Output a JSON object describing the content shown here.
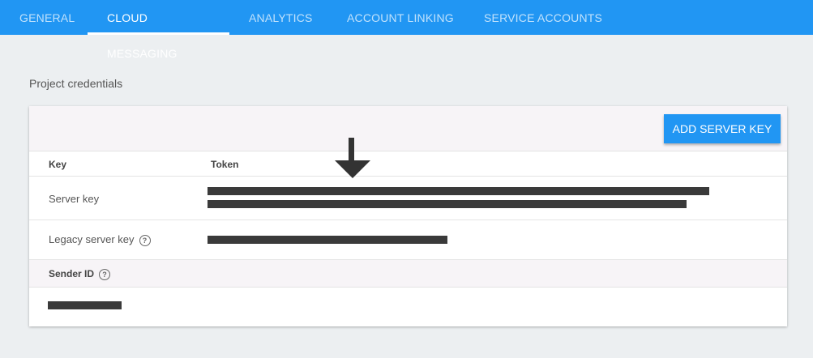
{
  "tabs": [
    {
      "label": "GENERAL"
    },
    {
      "label": "CLOUD MESSAGING"
    },
    {
      "label": "ANALYTICS"
    },
    {
      "label": "ACCOUNT LINKING"
    },
    {
      "label": "SERVICE ACCOUNTS"
    }
  ],
  "active_tab": "CLOUD MESSAGING",
  "section": {
    "title": "Project credentials"
  },
  "card": {
    "add_button_label": "ADD SERVER KEY",
    "columns": {
      "key": "Key",
      "token": "Token"
    },
    "rows": [
      {
        "label": "Server key"
      },
      {
        "label": "Legacy server key"
      }
    ],
    "sender_id_label": "Sender ID",
    "help_icon": "?"
  },
  "icons": [
    "help-circle-icon",
    "down-arrow-icon"
  ],
  "colors": {
    "tab_bar": "#2196f3",
    "button": "#2196f3",
    "redaction": "#3a3a3a"
  }
}
